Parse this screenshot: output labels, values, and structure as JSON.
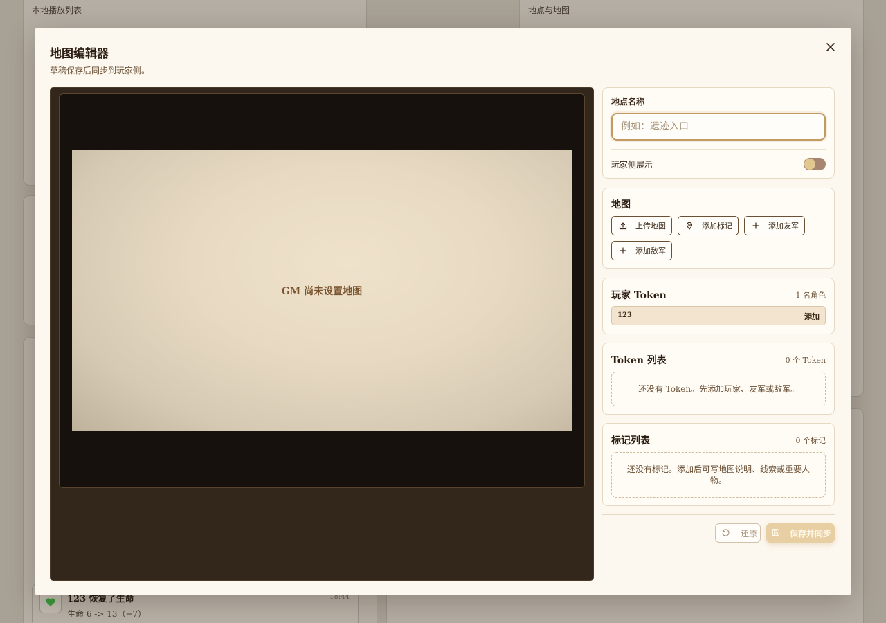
{
  "background": {
    "left_card": {
      "title": "本地播放列表"
    },
    "right_card": {
      "title": "地点与地图"
    },
    "feed_item": {
      "icon": "heart-icon",
      "title": "123 恢复了生命",
      "time": "18:44",
      "desc": "生命 6 -> 13（+7）"
    }
  },
  "modal": {
    "title": "地图编辑器",
    "subtitle": "草稿保存后同步到玩家侧。",
    "close_icon": "close-icon"
  },
  "map": {
    "empty_text": "GM 尚未设置地图"
  },
  "location": {
    "label": "地点名称",
    "value": "",
    "placeholder": "例如：遗迹入口",
    "player_display_label": "玩家侧展示",
    "player_display_on": false
  },
  "map_section": {
    "title": "地图",
    "buttons": [
      {
        "label": "上传地图",
        "icon": "upload-icon"
      },
      {
        "label": "添加标记",
        "icon": "pin-icon"
      },
      {
        "label": "添加友军",
        "icon": "plus-icon"
      },
      {
        "label": "添加敌军",
        "icon": "plus-icon"
      }
    ]
  },
  "player_tokens": {
    "title": "玩家 Token",
    "count": "1 名角色",
    "players": [
      {
        "name": "123",
        "action": "添加"
      }
    ]
  },
  "token_list": {
    "title": "Token 列表",
    "count": "0 个 Token",
    "empty": "还没有 Token。先添加玩家、友军或敌军。"
  },
  "marker_list": {
    "title": "标记列表",
    "count": "0 个标记",
    "empty": "还没有标记。添加后可写地图说明、线索或重要人物。"
  },
  "footer": {
    "revert_label": "还原",
    "save_label": "保存并同步"
  },
  "colors": {
    "accent": "#c29b62",
    "map_panel": "#33271c",
    "save_button": "#e8cfa3"
  }
}
